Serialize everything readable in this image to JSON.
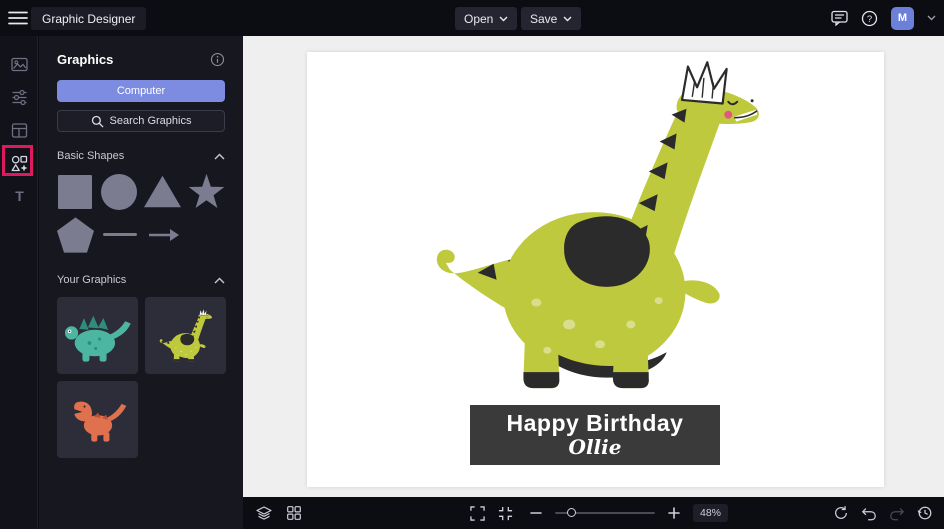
{
  "topbar": {
    "app_title": "Graphic Designer",
    "open_button": "Open",
    "save_button": "Save",
    "avatar_initial": "M"
  },
  "rail": {
    "tools": [
      "photos",
      "adjust",
      "templates",
      "graphics",
      "text"
    ],
    "active_tool": "graphics"
  },
  "panel": {
    "title": "Graphics",
    "computer_button": "Computer",
    "search_button": "Search Graphics",
    "basic_shapes_title": "Basic Shapes",
    "basic_shapes": [
      "square",
      "circle",
      "triangle",
      "star",
      "pentagon",
      "line",
      "arrow"
    ],
    "your_graphics_title": "Your Graphics",
    "your_graphics": [
      "teal-dinosaur",
      "yellow-dinosaur",
      "orange-dinosaur"
    ]
  },
  "canvas": {
    "artwork": "yellow-dinosaur-with-crown",
    "banner": {
      "line1": "Happy Birthday",
      "line2": "Ollie"
    }
  },
  "toolbar": {
    "zoom_percent": "48%"
  },
  "colors": {
    "accent_blue": "#7d8ce0",
    "annotation_pink": "#e0195f",
    "dino_green": "#bfc93e",
    "dino_teal": "#4db6a3",
    "dino_orange": "#e0714e",
    "banner_bg": "#3a3a3a",
    "chrome_bg": "#0c0c13",
    "panel_bg": "#17171f"
  }
}
